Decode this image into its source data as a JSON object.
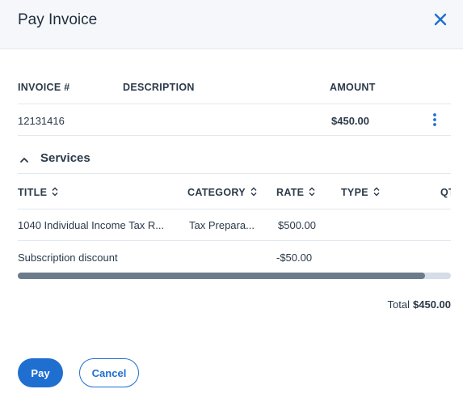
{
  "dialog": {
    "title": "Pay Invoice",
    "close_icon": "close-icon"
  },
  "invoice_table": {
    "headers": [
      "INVOICE #",
      "DESCRIPTION",
      "AMOUNT"
    ],
    "row": {
      "invoice_number": "12131416",
      "description": "",
      "amount": "$450.00",
      "menu_icon": "kebab-menu-icon"
    }
  },
  "services": {
    "label": "Services",
    "toggle_icon": "chevron-up-icon",
    "headers": [
      "TITLE",
      "CATEGORY",
      "RATE",
      "TYPE",
      "QT"
    ],
    "rows": [
      {
        "title": "1040 Individual Income Tax R...",
        "category": "Tax Prepara...",
        "rate": "$500.00",
        "type": ""
      },
      {
        "title": "Subscription discount",
        "category": "",
        "rate": "-$50.00",
        "type": ""
      }
    ],
    "scroll_position": 0.94
  },
  "summary": {
    "total_label": "Total",
    "total_value": "$450.00"
  },
  "actions": {
    "pay_label": "Pay",
    "cancel_label": "Cancel"
  },
  "colors": {
    "accent": "#1f6fd1",
    "header_bg": "#f5f7fa",
    "scroll_thumb": "#6c7b8c",
    "scroll_track": "#d5dde6"
  }
}
